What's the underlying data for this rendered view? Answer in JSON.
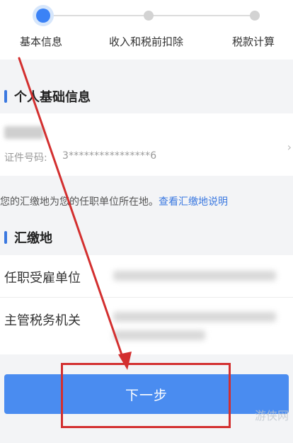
{
  "steps": [
    {
      "label": "基本信息",
      "active": true
    },
    {
      "label": "收入和税前扣除",
      "active": false
    },
    {
      "label": "税款计算",
      "active": false
    }
  ],
  "personal_section": {
    "title": "个人基础信息"
  },
  "identity": {
    "id_label": "证件号码:",
    "id_value": "3****************6",
    "chevron": "›"
  },
  "note": {
    "text": "您的汇缴地为您的任职单位所在地。",
    "link": "查看汇缴地说明"
  },
  "remit_section": {
    "title": "汇缴地"
  },
  "form": {
    "employer_label": "任职受雇单位",
    "tax_office_label": "主管税务机关"
  },
  "next_button": {
    "label": "下一步"
  },
  "annotation": {
    "color": "#d32f2f"
  },
  "accent_color": "#3a78e0",
  "watermark": "游侠网"
}
